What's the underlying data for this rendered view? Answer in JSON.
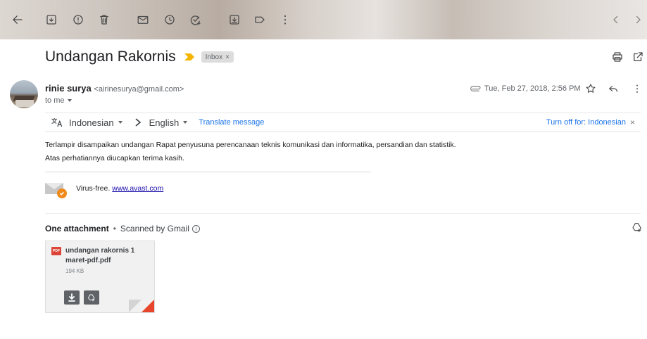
{
  "email": {
    "subject": "Undangan Rakornis",
    "label": "Inbox",
    "label_remove": "×",
    "sender_name": "rinie surya",
    "sender_email": "<airinesurya@gmail.com>",
    "recipient": "to me",
    "date": "Tue, Feb 27, 2018, 2:56 PM"
  },
  "translate": {
    "from_lang": "Indonesian",
    "to_lang": "English",
    "translate_link": "Translate message",
    "turn_off": "Turn off for: Indonesian",
    "close": "×"
  },
  "body": {
    "line1": "Terlampir disampaikan undangan Rapat penyusuna perencanaan teknis komunikasi dan informatika, persandian dan statistik.",
    "line2": "Atas perhatiannya diucapkan terima kasih."
  },
  "signature": {
    "virus_free": "Virus-free.",
    "link": "www.avast.com"
  },
  "attachments": {
    "heading": "One attachment",
    "separator": "•",
    "scanned": "Scanned by Gmail",
    "info_glyph": "i",
    "files": [
      {
        "badge": "PDF",
        "name": "undangan rakornis 1 maret-pdf.pdf",
        "size": "194 KB"
      }
    ]
  },
  "colors": {
    "accent_blue": "#1a73e8",
    "importance_yellow": "#f4b400",
    "pdf_red": "#db4437",
    "avast_orange": "#f08a1d"
  }
}
